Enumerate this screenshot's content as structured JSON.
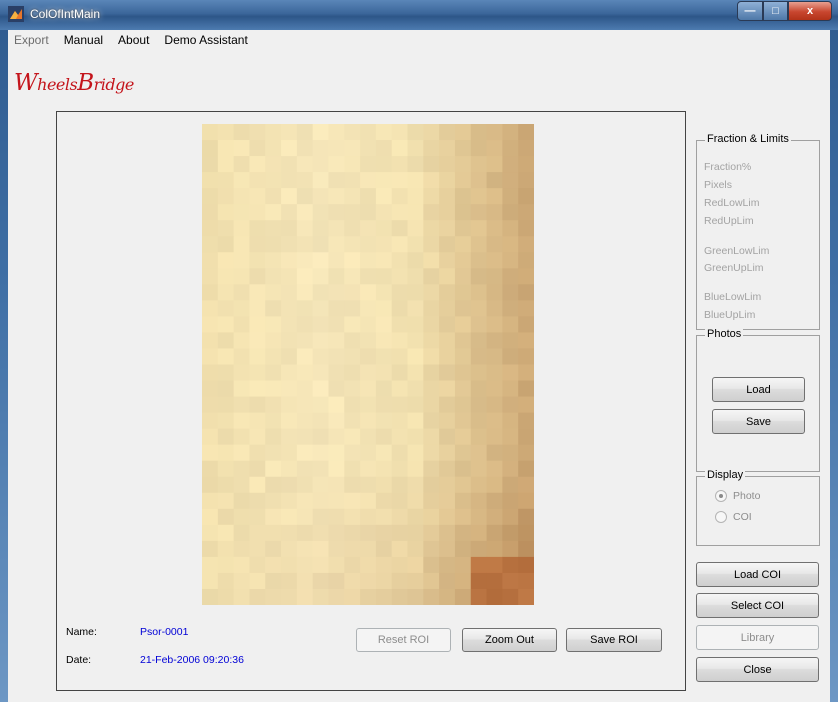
{
  "window": {
    "title": "ColOfIntMain",
    "controls": {
      "minimize": "—",
      "maximize": "□",
      "close": "x"
    }
  },
  "menu": [
    {
      "label": "Export",
      "enabled": false
    },
    {
      "label": "Manual",
      "enabled": true
    },
    {
      "label": "About",
      "enabled": true
    },
    {
      "label": "Demo Assistant",
      "enabled": true
    }
  ],
  "logo": {
    "cap1": "W",
    "rest1": "heels",
    "cap2": "B",
    "rest2": "ridge"
  },
  "info": {
    "name_label": "Name:",
    "name_value": "Psor-0001",
    "date_label": "Date:",
    "date_value": "21-Feb-2006 09:20:36"
  },
  "roi_buttons": {
    "reset": "Reset ROI",
    "zoom_out": "Zoom Out",
    "save": "Save ROI"
  },
  "fraction_limits": {
    "title": "Fraction & Limits",
    "labels": [
      "Fraction%",
      "Pixels",
      "RedLowLim",
      "RedUpLim",
      "GreenLowLim",
      "GreenUpLim",
      "BlueLowLim",
      "BlueUpLim"
    ]
  },
  "photos": {
    "title": "Photos",
    "load": "Load",
    "save": "Save"
  },
  "display": {
    "title": "Display",
    "options": [
      "Photo",
      "COI"
    ],
    "selected": "Photo"
  },
  "actions": {
    "load_coi": "Load COI",
    "select_coi": "Select COI",
    "library": "Library",
    "close": "Close"
  },
  "colors": {
    "name_value": "#0000d6",
    "logo": "#c4151c",
    "disabled_text": "#a3a3a3"
  }
}
